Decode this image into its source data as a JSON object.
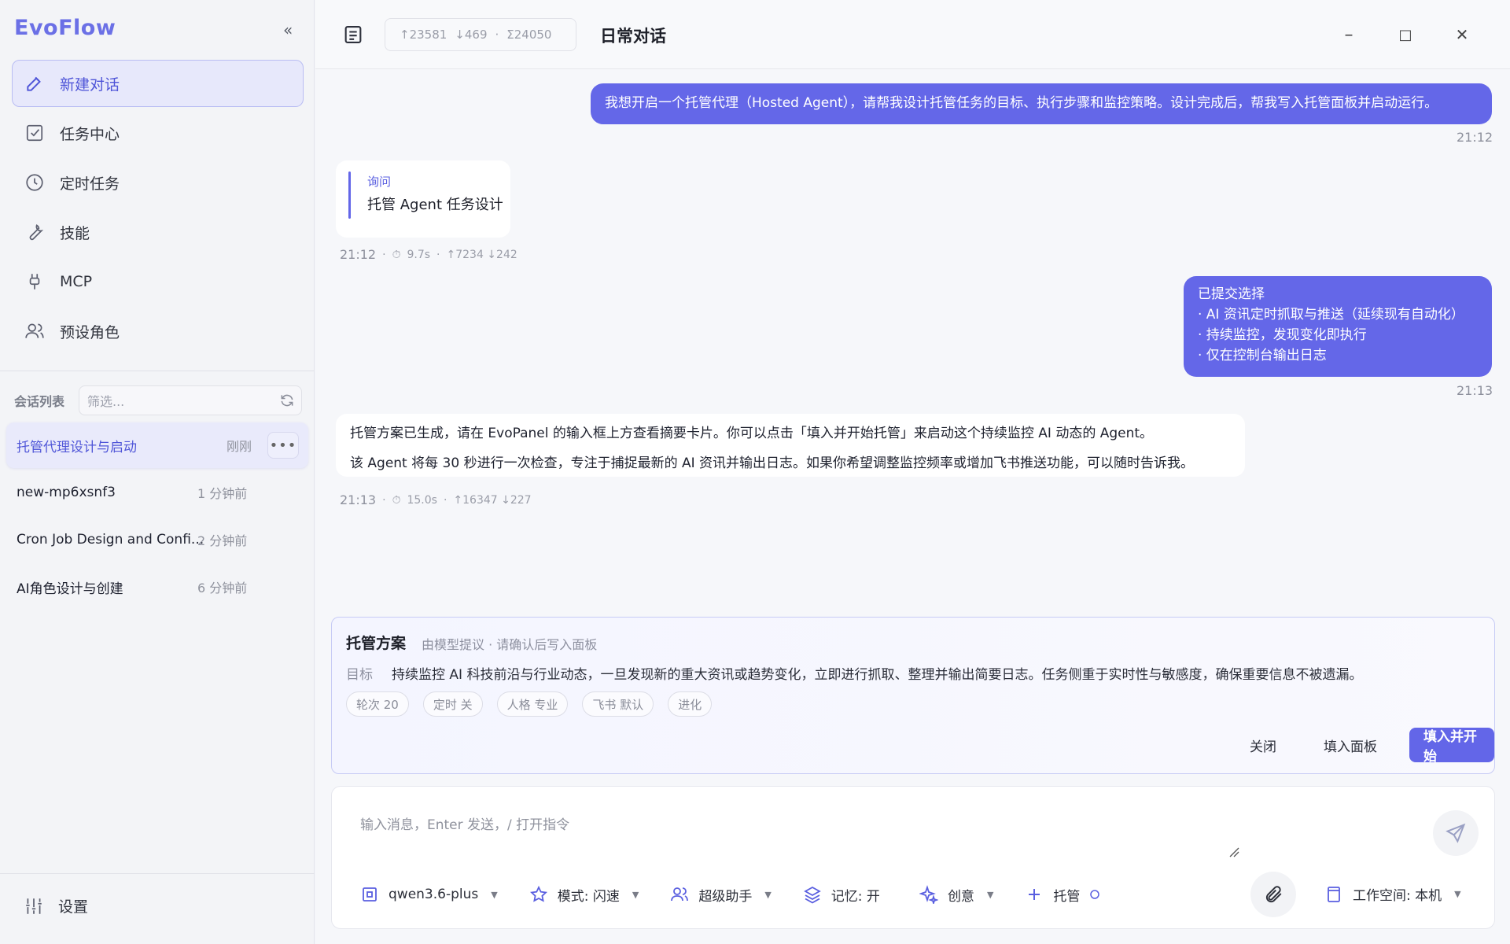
{
  "app": {
    "brand": "EvoFlow",
    "collapse_glyph": "«"
  },
  "nav": [
    {
      "label": "新建对话",
      "icon": "edit-icon"
    },
    {
      "label": "任务中心",
      "icon": "checkbox-icon"
    },
    {
      "label": "定时任务",
      "icon": "clock-icon"
    },
    {
      "label": "技能",
      "icon": "wrench-icon"
    },
    {
      "label": "MCP",
      "icon": "plug-icon"
    },
    {
      "label": "预设角色",
      "icon": "users-icon"
    }
  ],
  "sessions": {
    "title": "会话列表",
    "filter_placeholder": "筛选...",
    "items": [
      {
        "title": "托管代理设计与启动",
        "time": "刚刚",
        "more": "•••"
      },
      {
        "title": "new-mp6xsnf3",
        "time": "1 分钟前"
      },
      {
        "title": "Cron Job Design and Confi...",
        "time": "2 分钟前"
      },
      {
        "title": "AI角色设计与创建",
        "time": "6 分钟前"
      }
    ]
  },
  "settings_label": "设置",
  "topbar": {
    "tokens_in": "↑23581",
    "tokens_out": "↓469",
    "dot": "·",
    "tokens_total": "Σ24050",
    "title": "日常对话",
    "minimize": "–",
    "maximize": "□",
    "close": "✕"
  },
  "messages": {
    "user1": {
      "text": "我想开启一个托管代理（Hosted Agent），请帮我设计托管任务的目标、执行步骤和监控策略。设计完成后，帮我写入托管面板并启动运行。",
      "time": "21:12"
    },
    "ask": {
      "label": "询问",
      "value": "托管 Agent 任务设计",
      "time": "21:12",
      "duration": "9.7s",
      "tokens": "↑7234 ↓242"
    },
    "user2": {
      "lines": [
        "已提交选择",
        "· AI 资讯定时抓取与推送（延续现有自动化）",
        "· 持续监控，发现变化即执行",
        "· 仅在控制台输出日志"
      ],
      "time": "21:13"
    },
    "ai": {
      "line1": "托管方案已生成，请在 EvoPanel 的输入框上方查看摘要卡片。你可以点击「填入并开始托管」来启动这个持续监控 AI 动态的 Agent。",
      "line2": "该 Agent 将每 30 秒进行一次检查，专注于捕捉最新的 AI 资讯并输出日志。如果你希望调整监控频率或增加飞书推送功能，可以随时告诉我。",
      "time": "21:13",
      "duration": "15.0s",
      "tokens": "↑16347 ↓227"
    }
  },
  "plan": {
    "title": "托管方案",
    "subtitle": "由模型提议 · 请确认后写入面板",
    "goal_label": "目标",
    "goal_value": "持续监控 AI 科技前沿与行业动态，一旦发现新的重大资讯或趋势变化，立即进行抓取、整理并输出简要日志。任务侧重于实时性与敏感度，确保重要信息不被遗漏。",
    "chips": [
      "轮次 20",
      "定时 关",
      "人格 专业",
      "飞书 默认",
      "进化"
    ],
    "close": "关闭",
    "fill": "填入面板",
    "fill_start": "填入并开始"
  },
  "composer": {
    "placeholder": "输入消息，Enter 发送，/ 打开指令",
    "model": "qwen3.6-plus",
    "mode": "模式: 闪速",
    "role": "超级助手",
    "memory": "记忆: 开",
    "creative": "创意",
    "hosted": "托管",
    "workspace": "工作空间: 本机"
  },
  "colors": {
    "accent": "#6366e8",
    "accent_bg": "#e7e8fb"
  }
}
